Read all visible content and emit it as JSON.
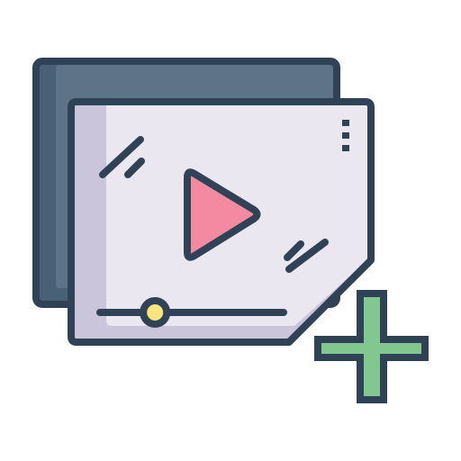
{
  "icon": {
    "name": "add-video-icon",
    "colors": {
      "outline": "#2f4256",
      "back_card": "#4a6077",
      "back_card_highlight": "#5f7388",
      "screen": "#ebe7f0",
      "screen_shade": "#cac5da",
      "play_button": "#f48aa1",
      "scrubber_knob": "#fbe37d",
      "plus": "#82c690"
    },
    "playback_progress": 0.3,
    "menu_dots": 3
  }
}
